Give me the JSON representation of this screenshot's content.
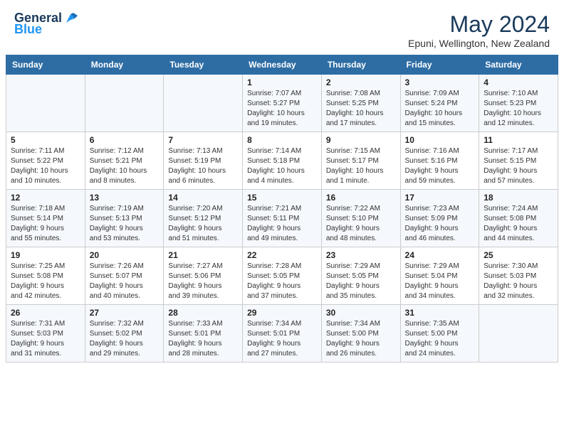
{
  "header": {
    "logo_line1": "General",
    "logo_line2": "Blue",
    "month": "May 2024",
    "location": "Epuni, Wellington, New Zealand"
  },
  "weekdays": [
    "Sunday",
    "Monday",
    "Tuesday",
    "Wednesday",
    "Thursday",
    "Friday",
    "Saturday"
  ],
  "weeks": [
    [
      {
        "day": "",
        "info": ""
      },
      {
        "day": "",
        "info": ""
      },
      {
        "day": "",
        "info": ""
      },
      {
        "day": "1",
        "info": "Sunrise: 7:07 AM\nSunset: 5:27 PM\nDaylight: 10 hours\nand 19 minutes."
      },
      {
        "day": "2",
        "info": "Sunrise: 7:08 AM\nSunset: 5:25 PM\nDaylight: 10 hours\nand 17 minutes."
      },
      {
        "day": "3",
        "info": "Sunrise: 7:09 AM\nSunset: 5:24 PM\nDaylight: 10 hours\nand 15 minutes."
      },
      {
        "day": "4",
        "info": "Sunrise: 7:10 AM\nSunset: 5:23 PM\nDaylight: 10 hours\nand 12 minutes."
      }
    ],
    [
      {
        "day": "5",
        "info": "Sunrise: 7:11 AM\nSunset: 5:22 PM\nDaylight: 10 hours\nand 10 minutes."
      },
      {
        "day": "6",
        "info": "Sunrise: 7:12 AM\nSunset: 5:21 PM\nDaylight: 10 hours\nand 8 minutes."
      },
      {
        "day": "7",
        "info": "Sunrise: 7:13 AM\nSunset: 5:19 PM\nDaylight: 10 hours\nand 6 minutes."
      },
      {
        "day": "8",
        "info": "Sunrise: 7:14 AM\nSunset: 5:18 PM\nDaylight: 10 hours\nand 4 minutes."
      },
      {
        "day": "9",
        "info": "Sunrise: 7:15 AM\nSunset: 5:17 PM\nDaylight: 10 hours\nand 1 minute."
      },
      {
        "day": "10",
        "info": "Sunrise: 7:16 AM\nSunset: 5:16 PM\nDaylight: 9 hours\nand 59 minutes."
      },
      {
        "day": "11",
        "info": "Sunrise: 7:17 AM\nSunset: 5:15 PM\nDaylight: 9 hours\nand 57 minutes."
      }
    ],
    [
      {
        "day": "12",
        "info": "Sunrise: 7:18 AM\nSunset: 5:14 PM\nDaylight: 9 hours\nand 55 minutes."
      },
      {
        "day": "13",
        "info": "Sunrise: 7:19 AM\nSunset: 5:13 PM\nDaylight: 9 hours\nand 53 minutes."
      },
      {
        "day": "14",
        "info": "Sunrise: 7:20 AM\nSunset: 5:12 PM\nDaylight: 9 hours\nand 51 minutes."
      },
      {
        "day": "15",
        "info": "Sunrise: 7:21 AM\nSunset: 5:11 PM\nDaylight: 9 hours\nand 49 minutes."
      },
      {
        "day": "16",
        "info": "Sunrise: 7:22 AM\nSunset: 5:10 PM\nDaylight: 9 hours\nand 48 minutes."
      },
      {
        "day": "17",
        "info": "Sunrise: 7:23 AM\nSunset: 5:09 PM\nDaylight: 9 hours\nand 46 minutes."
      },
      {
        "day": "18",
        "info": "Sunrise: 7:24 AM\nSunset: 5:08 PM\nDaylight: 9 hours\nand 44 minutes."
      }
    ],
    [
      {
        "day": "19",
        "info": "Sunrise: 7:25 AM\nSunset: 5:08 PM\nDaylight: 9 hours\nand 42 minutes."
      },
      {
        "day": "20",
        "info": "Sunrise: 7:26 AM\nSunset: 5:07 PM\nDaylight: 9 hours\nand 40 minutes."
      },
      {
        "day": "21",
        "info": "Sunrise: 7:27 AM\nSunset: 5:06 PM\nDaylight: 9 hours\nand 39 minutes."
      },
      {
        "day": "22",
        "info": "Sunrise: 7:28 AM\nSunset: 5:05 PM\nDaylight: 9 hours\nand 37 minutes."
      },
      {
        "day": "23",
        "info": "Sunrise: 7:29 AM\nSunset: 5:05 PM\nDaylight: 9 hours\nand 35 minutes."
      },
      {
        "day": "24",
        "info": "Sunrise: 7:29 AM\nSunset: 5:04 PM\nDaylight: 9 hours\nand 34 minutes."
      },
      {
        "day": "25",
        "info": "Sunrise: 7:30 AM\nSunset: 5:03 PM\nDaylight: 9 hours\nand 32 minutes."
      }
    ],
    [
      {
        "day": "26",
        "info": "Sunrise: 7:31 AM\nSunset: 5:03 PM\nDaylight: 9 hours\nand 31 minutes."
      },
      {
        "day": "27",
        "info": "Sunrise: 7:32 AM\nSunset: 5:02 PM\nDaylight: 9 hours\nand 29 minutes."
      },
      {
        "day": "28",
        "info": "Sunrise: 7:33 AM\nSunset: 5:01 PM\nDaylight: 9 hours\nand 28 minutes."
      },
      {
        "day": "29",
        "info": "Sunrise: 7:34 AM\nSunset: 5:01 PM\nDaylight: 9 hours\nand 27 minutes."
      },
      {
        "day": "30",
        "info": "Sunrise: 7:34 AM\nSunset: 5:00 PM\nDaylight: 9 hours\nand 26 minutes."
      },
      {
        "day": "31",
        "info": "Sunrise: 7:35 AM\nSunset: 5:00 PM\nDaylight: 9 hours\nand 24 minutes."
      },
      {
        "day": "",
        "info": ""
      }
    ]
  ]
}
